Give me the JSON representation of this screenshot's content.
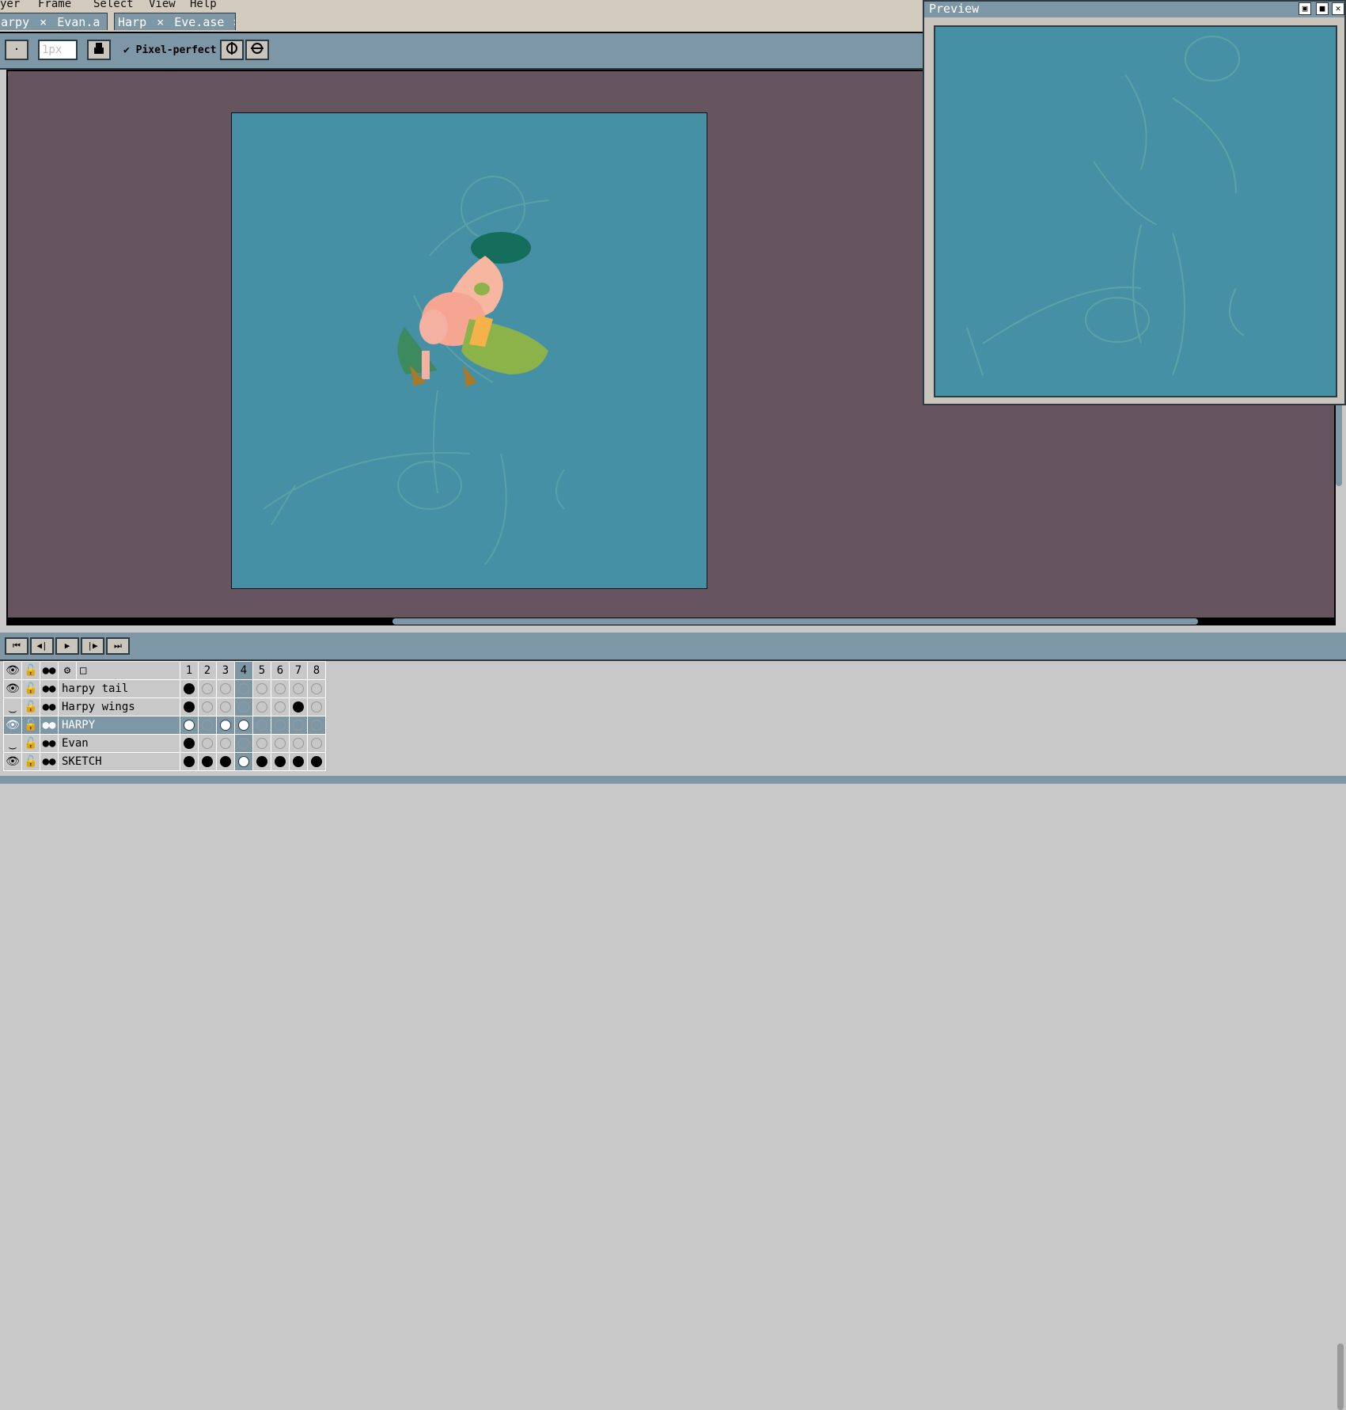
{
  "menu": [
    "yer",
    "Frame",
    "Select",
    "View",
    "Help"
  ],
  "tabs": [
    {
      "label": "arpy",
      "close": "×",
      "extra": "Evan.a",
      "modified": "●"
    },
    {
      "label": "Harp",
      "close": "×",
      "extra": "Eve.ase",
      "end_close": "×"
    }
  ],
  "toolbar": {
    "brush_size_placeholder": "1px",
    "pixel_perfect_check": "✔",
    "pixel_perfect_label": "Pixel-perfect"
  },
  "preview": {
    "title": "Preview"
  },
  "playback": [
    "⏮",
    "◀|",
    "▶",
    "|▶",
    "⏭"
  ],
  "timeline": {
    "frame_numbers": [
      "1",
      "2",
      "3",
      "4",
      "5",
      "6",
      "7",
      "8"
    ],
    "current_frame": "4",
    "layers": [
      {
        "name": "harpy tail",
        "visible": "visible",
        "cels": [
          "full",
          "empty",
          "empty",
          "empty",
          "empty",
          "empty",
          "empty",
          "empty"
        ]
      },
      {
        "name": "Harpy wings",
        "visible": "hidden",
        "cels": [
          "full",
          "empty",
          "empty",
          "empty",
          "empty",
          "empty",
          "full",
          "empty"
        ]
      },
      {
        "name": "HARPY",
        "visible": "visible",
        "cels": [
          "white",
          "empty",
          "white",
          "white",
          "empty",
          "empty",
          "empty",
          "empty"
        ],
        "selected": true
      },
      {
        "name": "Evan",
        "visible": "hidden",
        "cels": [
          "full",
          "empty",
          "empty",
          "empty",
          "empty",
          "empty",
          "empty",
          "empty"
        ]
      },
      {
        "name": "SKETCH",
        "visible": "visible",
        "cels": [
          "full",
          "full",
          "full",
          "white",
          "full",
          "full",
          "full",
          "full"
        ]
      }
    ]
  },
  "colors": {
    "canvas_bg": "#4590a4",
    "editor_bg": "#66555f",
    "panel": "#7e97a6",
    "chrome": "#d3cbbd"
  }
}
